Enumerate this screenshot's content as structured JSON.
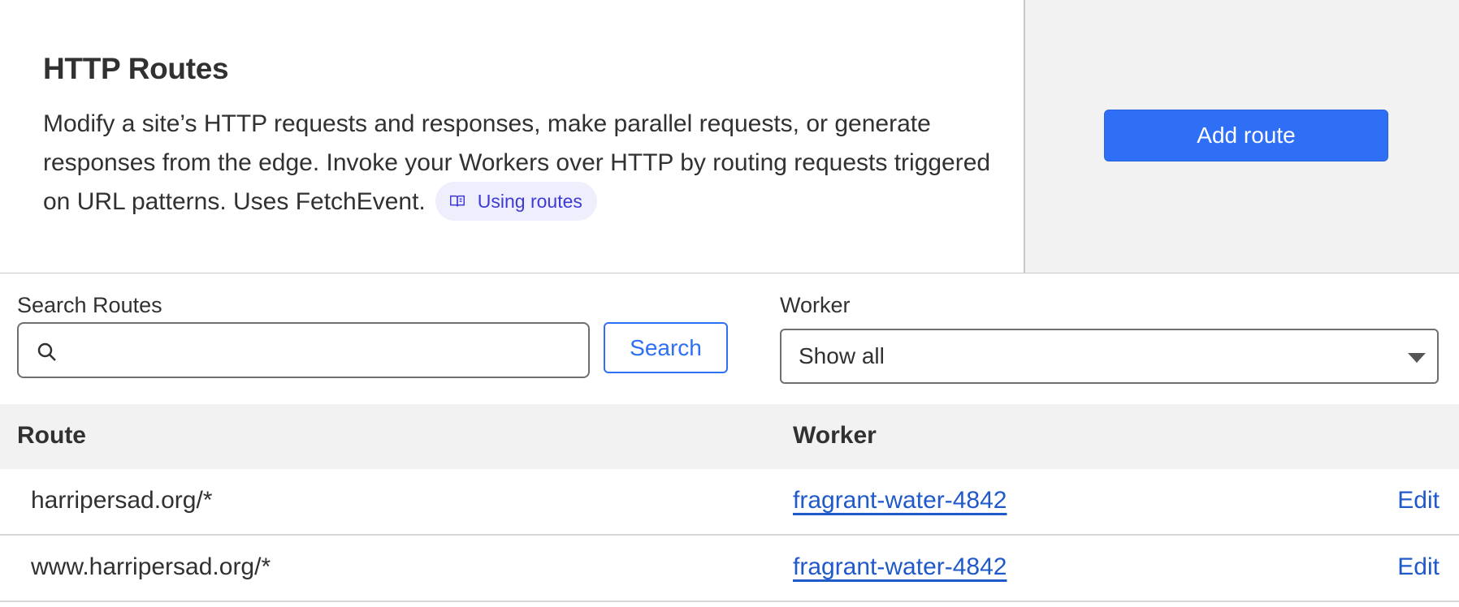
{
  "header": {
    "title": "HTTP Routes",
    "description": "Modify a site’s HTTP requests and responses, make parallel requests, or generate responses from the edge. Invoke your Workers over HTTP by routing requests triggered on URL patterns. Uses FetchEvent.",
    "doc_link_label": "Using routes",
    "doc_link_icon": "book-icon"
  },
  "actions": {
    "add_route_label": "Add route"
  },
  "filters": {
    "search_label": "Search Routes",
    "search_value": "",
    "search_placeholder": "",
    "search_icon": "search-icon",
    "search_button_label": "Search",
    "worker_label": "Worker",
    "worker_selected": "Show all"
  },
  "table": {
    "columns": [
      "Route",
      "Worker"
    ],
    "rows": [
      {
        "route": "harripersad.org/*",
        "worker": "fragrant-water-4842",
        "action": "Edit"
      },
      {
        "route": "www.harripersad.org/*",
        "worker": "fragrant-water-4842",
        "action": "Edit"
      }
    ]
  },
  "colors": {
    "accent": "#2f6ff5",
    "link": "#2059c9",
    "pill_bg": "#efeefc",
    "pill_text": "#3d3ad6",
    "panel_bg": "#f2f2f2"
  }
}
